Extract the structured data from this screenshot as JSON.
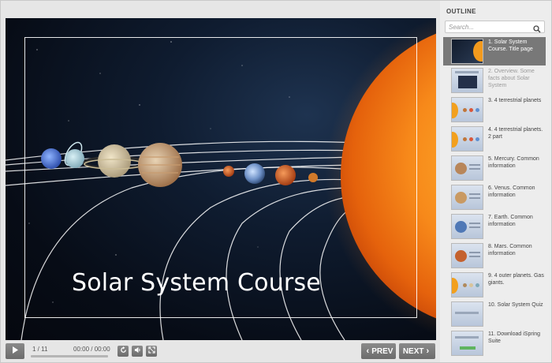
{
  "slide": {
    "title": "Solar System Course"
  },
  "controls": {
    "counter": "1 / 11",
    "time": "00:00 / 00:00",
    "prev_label": "PREV",
    "next_label": "NEXT",
    "progress": 0,
    "icons": {
      "play": "play-icon",
      "replay": "replay-icon",
      "volume": "volume-icon",
      "fullscreen": "fullscreen-icon",
      "prev": "chevron-left-icon",
      "next": "chevron-right-icon"
    }
  },
  "outline": {
    "heading": "OUTLINE",
    "search_placeholder": "Search...",
    "search_icon": "search-icon",
    "items": [
      {
        "label": "1. Solar System Course. Title page",
        "active": true
      },
      {
        "label": "2. Overview. Some facts about Solar System"
      },
      {
        "label": "3. 4 terrestrial planets"
      },
      {
        "label": "4. 4 terrestrial planets. 2 part"
      },
      {
        "label": "5. Mercury. Common information"
      },
      {
        "label": "6. Venus. Common information"
      },
      {
        "label": "7. Earth. Common information"
      },
      {
        "label": "8. Mars. Common information"
      },
      {
        "label": "9. 4 outer planets. Gas giants."
      },
      {
        "label": "10. Solar System Quiz"
      },
      {
        "label": "11. Download iSpring Suite"
      }
    ]
  },
  "colors": {
    "sun": "#f28a1c",
    "active_item": "#787878",
    "button": "#7a7a7a"
  }
}
